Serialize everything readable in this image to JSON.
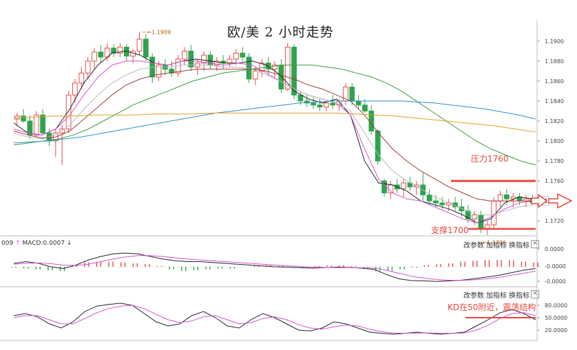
{
  "title": "欧/美 2 小时走势",
  "colors": {
    "up": "#e84b4b",
    "down": "#2fa44f",
    "ma_black": "#222222",
    "ma_pink": "#d64fd6",
    "ma_gray": "#b9b9b9",
    "ma_darkred": "#9b3b3b",
    "ma_green": "#3a9a3a",
    "ma_blue": "#2a8fd0",
    "ma_orange": "#e6a020",
    "annotation": "#e8463c"
  },
  "main": {
    "y_ticks": [
      "1.1900",
      "1.1880",
      "1.1860",
      "1.1840",
      "1.1820",
      "1.1800",
      "1.1780",
      "1.1760",
      "1.1740",
      "1.1720"
    ],
    "high_label": "1.1909",
    "low_label": "1.1706",
    "resistance_label": "压力1760",
    "support_label": "支撑1700"
  },
  "macd": {
    "label_prefix": "009",
    "label": "MACD:0.0007",
    "y_ticks": [
      "0.0000",
      "-0.0000",
      "-0.0000"
    ],
    "btn_params": "改参数",
    "btn_add": "加指标",
    "btn_swap": "换指标",
    "close": "×"
  },
  "kd": {
    "y_ticks": [
      "80.0000",
      "50.0000",
      "20.0000"
    ],
    "btn_params": "改参数",
    "btn_add": "加指标",
    "btn_swap": "换指标",
    "close": "×",
    "annotation": "KD在50附近，震荡结构"
  },
  "chart_data": {
    "type": "candlestick",
    "title": "欧/美 2 小时走势",
    "ylim": [
      1.1705,
      1.1915
    ],
    "y_ticks": [
      1.19,
      1.188,
      1.186,
      1.184,
      1.182,
      1.18,
      1.178,
      1.176,
      1.174,
      1.172
    ],
    "resistance": 1.176,
    "support": 1.1712,
    "high": 1.1909,
    "low": 1.1706,
    "candles": [
      [
        1.1822,
        1.1828,
        1.1815,
        1.1825
      ],
      [
        1.1825,
        1.1832,
        1.1818,
        1.182
      ],
      [
        1.182,
        1.1826,
        1.1802,
        1.1806
      ],
      [
        1.1806,
        1.183,
        1.1804,
        1.1826
      ],
      [
        1.1826,
        1.1832,
        1.1806,
        1.1808
      ],
      [
        1.1808,
        1.1812,
        1.1795,
        1.18
      ],
      [
        1.18,
        1.1812,
        1.1784,
        1.1808
      ],
      [
        1.1808,
        1.1816,
        1.1776,
        1.1812
      ],
      [
        1.1812,
        1.185,
        1.1808,
        1.1846
      ],
      [
        1.1846,
        1.1862,
        1.1838,
        1.1858
      ],
      [
        1.1858,
        1.1874,
        1.1852,
        1.1868
      ],
      [
        1.1868,
        1.1884,
        1.1862,
        1.188
      ],
      [
        1.188,
        1.1893,
        1.1872,
        1.1889
      ],
      [
        1.1889,
        1.1896,
        1.1878,
        1.1884
      ],
      [
        1.1884,
        1.1898,
        1.188,
        1.1893
      ],
      [
        1.1893,
        1.1897,
        1.1884,
        1.1888
      ],
      [
        1.1888,
        1.1898,
        1.1884,
        1.1894
      ],
      [
        1.1894,
        1.1897,
        1.188,
        1.1885
      ],
      [
        1.1885,
        1.1892,
        1.1878,
        1.189
      ],
      [
        1.189,
        1.1909,
        1.1886,
        1.1902
      ],
      [
        1.1902,
        1.1907,
        1.188,
        1.1884
      ],
      [
        1.1884,
        1.1888,
        1.1858,
        1.1864
      ],
      [
        1.1864,
        1.188,
        1.186,
        1.1876
      ],
      [
        1.1876,
        1.1882,
        1.1866,
        1.1872
      ],
      [
        1.1872,
        1.188,
        1.1864,
        1.1868
      ],
      [
        1.1868,
        1.1886,
        1.1864,
        1.1882
      ],
      [
        1.1882,
        1.1894,
        1.1876,
        1.189
      ],
      [
        1.189,
        1.1896,
        1.187,
        1.1874
      ],
      [
        1.1874,
        1.1882,
        1.1866,
        1.1878
      ],
      [
        1.1878,
        1.189,
        1.187,
        1.1886
      ],
      [
        1.1886,
        1.189,
        1.1872,
        1.1876
      ],
      [
        1.1876,
        1.1884,
        1.187,
        1.188
      ],
      [
        1.188,
        1.1886,
        1.1872,
        1.1878
      ],
      [
        1.1878,
        1.1886,
        1.1874,
        1.1882
      ],
      [
        1.1882,
        1.1892,
        1.1876,
        1.1888
      ],
      [
        1.1888,
        1.1894,
        1.188,
        1.1884
      ],
      [
        1.1884,
        1.1888,
        1.1858,
        1.1862
      ],
      [
        1.1862,
        1.1874,
        1.1856,
        1.187
      ],
      [
        1.187,
        1.1882,
        1.1864,
        1.1878
      ],
      [
        1.1878,
        1.1884,
        1.1866,
        1.1872
      ],
      [
        1.1872,
        1.188,
        1.1864,
        1.1876
      ],
      [
        1.1876,
        1.1882,
        1.1848,
        1.1852
      ],
      [
        1.1852,
        1.1898,
        1.185,
        1.1894
      ],
      [
        1.1894,
        1.1897,
        1.1842,
        1.1846
      ],
      [
        1.1846,
        1.185,
        1.1836,
        1.184
      ],
      [
        1.184,
        1.1846,
        1.1834,
        1.1838
      ],
      [
        1.1838,
        1.1844,
        1.1832,
        1.1836
      ],
      [
        1.1836,
        1.1842,
        1.183,
        1.1834
      ],
      [
        1.1834,
        1.184,
        1.183,
        1.1838
      ],
      [
        1.1838,
        1.1846,
        1.1832,
        1.1836
      ],
      [
        1.1836,
        1.1842,
        1.183,
        1.184
      ],
      [
        1.184,
        1.1858,
        1.1836,
        1.1854
      ],
      [
        1.1854,
        1.1858,
        1.1836,
        1.184
      ],
      [
        1.184,
        1.1846,
        1.1832,
        1.1836
      ],
      [
        1.1836,
        1.1842,
        1.1828,
        1.183
      ],
      [
        1.183,
        1.1836,
        1.1806,
        1.181
      ],
      [
        1.181,
        1.1812,
        1.1776,
        1.178
      ],
      [
        1.176,
        1.1762,
        1.1744,
        1.1748
      ],
      [
        1.1748,
        1.176,
        1.1742,
        1.1756
      ],
      [
        1.1756,
        1.1762,
        1.1748,
        1.1752
      ],
      [
        1.1752,
        1.1762,
        1.1744,
        1.1758
      ],
      [
        1.1758,
        1.1764,
        1.175,
        1.1754
      ],
      [
        1.1754,
        1.176,
        1.1746,
        1.1756
      ],
      [
        1.1756,
        1.1768,
        1.174,
        1.1746
      ],
      [
        1.1746,
        1.1752,
        1.1736,
        1.174
      ],
      [
        1.174,
        1.1746,
        1.1734,
        1.1738
      ],
      [
        1.1738,
        1.1744,
        1.1732,
        1.1736
      ],
      [
        1.1736,
        1.1742,
        1.173,
        1.1738
      ],
      [
        1.1738,
        1.1744,
        1.173,
        1.1734
      ],
      [
        1.1734,
        1.1742,
        1.1724,
        1.173
      ],
      [
        1.173,
        1.1736,
        1.1718,
        1.1722
      ],
      [
        1.1722,
        1.173,
        1.1716,
        1.1726
      ],
      [
        1.1726,
        1.173,
        1.1708,
        1.1712
      ],
      [
        1.1712,
        1.172,
        1.1706,
        1.1716
      ],
      [
        1.1716,
        1.1744,
        1.1712,
        1.174
      ],
      [
        1.174,
        1.175,
        1.1734,
        1.1746
      ],
      [
        1.1746,
        1.1752,
        1.1736,
        1.1742
      ],
      [
        1.1742,
        1.1748,
        1.1734,
        1.1744
      ],
      [
        1.1744,
        1.1748,
        1.1736,
        1.174
      ],
      [
        1.174,
        1.1746,
        1.1734,
        1.1742
      ],
      [
        1.1742,
        1.1746,
        1.1736,
        1.1738
      ]
    ],
    "moving_averages": [
      {
        "color": "#222222",
        "values": [
          1.1818,
          1.1808,
          1.1806,
          1.1812,
          1.1832,
          1.1858,
          1.1876,
          1.1888,
          1.189,
          1.1886,
          1.1878,
          1.1876,
          1.188,
          1.1882,
          1.188,
          1.1878,
          1.1878,
          1.188,
          1.1876,
          1.1866,
          1.185,
          1.1842,
          1.1838,
          1.1842,
          1.1826,
          1.178,
          1.1758,
          1.1756,
          1.175,
          1.174,
          1.1736,
          1.1732,
          1.1726,
          1.1718,
          1.1722,
          1.1738,
          1.1744,
          1.1742
        ]
      },
      {
        "color": "#d64fd6",
        "values": [
          1.1812,
          1.1808,
          1.1806,
          1.1812,
          1.1826,
          1.1846,
          1.1864,
          1.1876,
          1.188,
          1.188,
          1.1878,
          1.1876,
          1.188,
          1.188,
          1.1878,
          1.1876,
          1.1878,
          1.1876,
          1.1868,
          1.186,
          1.1852,
          1.1846,
          1.1842,
          1.1838,
          1.1826,
          1.1792,
          1.1762,
          1.1748,
          1.1742,
          1.174,
          1.1734,
          1.1728,
          1.1722,
          1.1718,
          1.1724,
          1.1732,
          1.1738,
          1.174
        ]
      },
      {
        "color": "#b9b9b9",
        "values": [
          1.1808,
          1.1804,
          1.1802,
          1.1806,
          1.1816,
          1.1832,
          1.1846,
          1.1858,
          1.1866,
          1.1872,
          1.1874,
          1.1874,
          1.1876,
          1.1876,
          1.1876,
          1.1874,
          1.1874,
          1.1872,
          1.1866,
          1.186,
          1.1852,
          1.1846,
          1.1842,
          1.1838,
          1.183,
          1.1808,
          1.1786,
          1.177,
          1.176,
          1.1752,
          1.1744,
          1.1738,
          1.1732,
          1.1726,
          1.1726,
          1.173,
          1.1734,
          1.1736
        ]
      },
      {
        "color": "#9b3b3b",
        "values": [
          1.181,
          1.1806,
          1.1803,
          1.1804,
          1.181,
          1.1822,
          1.1834,
          1.1846,
          1.1856,
          1.1862,
          1.1866,
          1.1868,
          1.187,
          1.1872,
          1.1872,
          1.1872,
          1.1872,
          1.1872,
          1.187,
          1.1866,
          1.1862,
          1.1856,
          1.1852,
          1.1846,
          1.184,
          1.1826,
          1.1808,
          1.1792,
          1.178,
          1.177,
          1.1762,
          1.1754,
          1.1748,
          1.1742,
          1.174,
          1.174,
          1.174,
          1.174
        ]
      },
      {
        "color": "#3a9a3a",
        "values": [
          1.1796,
          1.1798,
          1.18,
          1.1802,
          1.1806,
          1.1812,
          1.182,
          1.1828,
          1.1836,
          1.1842,
          1.1848,
          1.1854,
          1.186,
          1.1864,
          1.1868,
          1.187,
          1.1872,
          1.1874,
          1.1876,
          1.1876,
          1.1876,
          1.1874,
          1.1872,
          1.1868,
          1.1864,
          1.1858,
          1.185,
          1.184,
          1.183,
          1.182,
          1.181,
          1.18,
          1.1792,
          1.1786,
          1.178,
          1.1776
        ]
      },
      {
        "color": "#2a8fd0",
        "values": [
          1.1798,
          1.1799,
          1.18,
          1.1802,
          1.1804,
          1.1807,
          1.181,
          1.1813,
          1.1816,
          1.1819,
          1.1822,
          1.1825,
          1.1828,
          1.183,
          1.1832,
          1.1834,
          1.1836,
          1.1838,
          1.1839,
          1.184,
          1.184,
          1.184,
          1.184,
          1.184,
          1.1839,
          1.1838,
          1.1836,
          1.1834,
          1.1832,
          1.1829,
          1.1826,
          1.1822
        ]
      },
      {
        "color": "#e6a020",
        "values": [
          1.1823,
          1.1824,
          1.1825,
          1.1825,
          1.1826,
          1.1826,
          1.1826,
          1.1827,
          1.1827,
          1.1827,
          1.1828,
          1.1828,
          1.1828,
          1.1828,
          1.1828,
          1.1828,
          1.1828,
          1.1827,
          1.1826,
          1.1825,
          1.1823,
          1.1821,
          1.1819,
          1.1817,
          1.1815,
          1.1812,
          1.1809
        ]
      }
    ],
    "macd": {
      "macd_line": [
        0.2,
        0.3,
        0.2,
        0.0,
        -0.1,
        0.1,
        0.4,
        0.6,
        0.75,
        0.8,
        0.75,
        0.6,
        0.45,
        0.35,
        0.3,
        0.3,
        0.25,
        0.2,
        0.15,
        0.1,
        0.05,
        0.0,
        -0.02,
        -0.05,
        -0.08,
        -0.05,
        -0.02,
        -0.04,
        -0.08,
        -0.15,
        -0.45,
        -0.7,
        -0.8,
        -0.82,
        -0.85,
        -0.82,
        -0.78,
        -0.7,
        -0.6,
        -0.5,
        -0.35,
        -0.2,
        -0.1
      ],
      "signal_line": [
        0.15,
        0.2,
        0.22,
        0.18,
        0.1,
        0.08,
        0.15,
        0.3,
        0.45,
        0.58,
        0.65,
        0.65,
        0.6,
        0.52,
        0.45,
        0.4,
        0.35,
        0.3,
        0.25,
        0.2,
        0.15,
        0.1,
        0.06,
        0.02,
        -0.02,
        -0.04,
        -0.05,
        -0.05,
        -0.06,
        -0.08,
        -0.2,
        -0.38,
        -0.55,
        -0.66,
        -0.74,
        -0.78,
        -0.79,
        -0.76,
        -0.7,
        -0.62,
        -0.5,
        -0.38,
        -0.25
      ],
      "histogram": [
        -0.05,
        -0.1,
        -0.15,
        -0.2,
        -0.25,
        0.1,
        0.25,
        0.3,
        0.3,
        0.25,
        0.2,
        0.15,
        0.05,
        -0.15,
        -0.25,
        -0.2,
        -0.15,
        -0.1,
        -0.1,
        0.0,
        0.08,
        0.1,
        0.05,
        0.0,
        -0.05,
        0.05,
        0.08,
        0.1,
        0.05,
        -0.05,
        -0.25,
        -0.25,
        -0.15,
        -0.05,
        0.1,
        0.15,
        0.2,
        0.3,
        0.35,
        0.4,
        0.4,
        0.38,
        0.3,
        0.25
      ]
    },
    "kd": {
      "k": [
        55,
        60,
        52,
        35,
        25,
        40,
        65,
        78,
        82,
        85,
        80,
        60,
        40,
        30,
        35,
        55,
        65,
        50,
        30,
        25,
        45,
        60,
        50,
        35,
        20,
        18,
        25,
        40,
        35,
        25,
        15,
        12,
        10,
        12,
        15,
        12,
        10,
        12,
        15,
        30,
        45,
        62,
        70,
        60,
        45
      ],
      "d": [
        50,
        55,
        55,
        45,
        35,
        35,
        48,
        62,
        72,
        78,
        80,
        72,
        58,
        45,
        38,
        42,
        52,
        55,
        45,
        35,
        38,
        48,
        52,
        45,
        33,
        25,
        22,
        28,
        32,
        30,
        22,
        16,
        13,
        12,
        13,
        13,
        12,
        12,
        13,
        20,
        32,
        48,
        60,
        62,
        55
      ]
    }
  }
}
